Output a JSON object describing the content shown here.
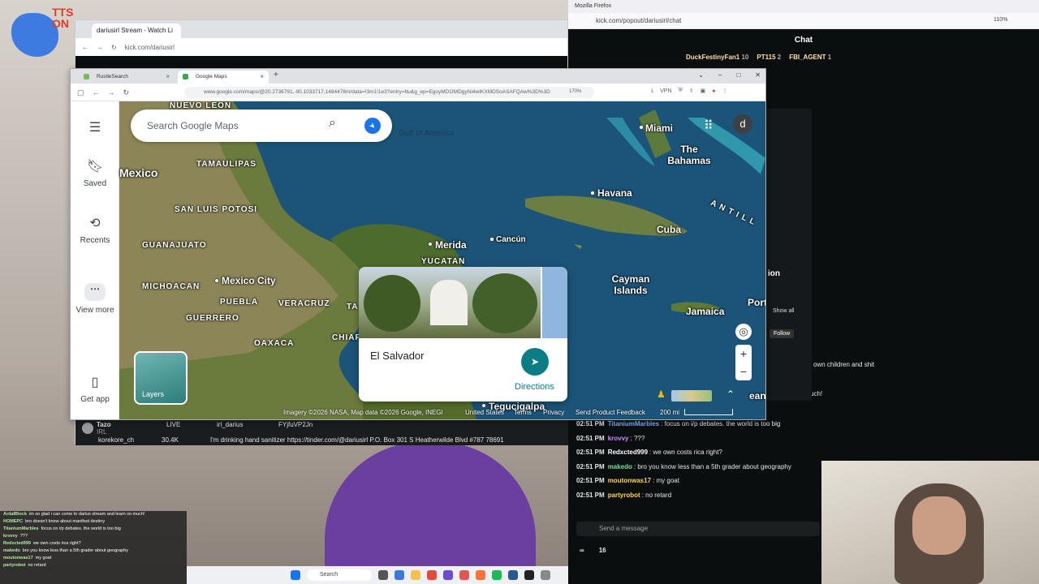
{
  "overlay_logo": {
    "text_line1": "TTS",
    "text_line2": "ON"
  },
  "stream_window": {
    "tab_title": "dariusirl Stream - Watch Li",
    "url": "kick.com/dariusirl",
    "streamer": "Tazo",
    "streamer_sub": "IRL",
    "live_label": "LIVE",
    "viewer_user": "korekore_ch",
    "viewer_count": "30.4K",
    "handle_x": "irl_darius",
    "handle_discord": "FYjfuVP2Jn",
    "ticker": "I'm drinking hand sanitizer https://tinder.com/@dariusirl P.O. Box 301 S Heatherwilde Blvd #787 78691"
  },
  "chat_window": {
    "ff_title": "Mozilla Firefox",
    "url": "kick.com/popout/dariusirl/chat",
    "zoom": "110%",
    "header": "Chat",
    "leaders": [
      {
        "name": "DuckFestinyFan1",
        "count": "10"
      },
      {
        "name": "PT115",
        "count": "2"
      },
      {
        "name": "FBI_AGENT",
        "count": "1"
      }
    ],
    "messages": [
      {
        "time": "02:51 PM",
        "user": "TitaniumMarbles",
        "text": "focus on i/p debates. the world is too big",
        "color": "#7fb3ff"
      },
      {
        "time": "02:51 PM",
        "user": "krovvy",
        "text": "???",
        "color": "#c78bff"
      },
      {
        "time": "02:51 PM",
        "user": "Redxcted999",
        "text": "we own costs rica right?",
        "color": "#ffffff"
      },
      {
        "time": "02:51 PM",
        "user": "makedo",
        "text": "bro you know less than a 5th grader about geography",
        "color": "#6fe0a0"
      },
      {
        "time": "02:51 PM",
        "user": "moutonwas17",
        "text": "my goat",
        "color": "#ffd24d"
      },
      {
        "time": "02:51 PM",
        "user": "partyrobot",
        "text": "no retard",
        "color": "#ffd24d"
      }
    ],
    "input_placeholder": "Send a message",
    "footer_count": "16",
    "side_labels": {
      "show_all": "Show all",
      "follow": "Follow",
      "snippet1": "own children and shit",
      "snippet2": "uch!",
      "snippet3": "ion"
    }
  },
  "overlay_chat": [
    {
      "user": "ArdalBlock",
      "text": "im so glad i can come to darius stream and learn so much!"
    },
    {
      "user": "HOMEPC",
      "text": "bro doesn't know about manifest destiny"
    },
    {
      "user": "TitaniumMarbles",
      "text": "focus on i/p debates. the world is too big"
    },
    {
      "user": "krovvy",
      "text": "???"
    },
    {
      "user": "Redxcted999",
      "text": "we own costs rica right?"
    },
    {
      "user": "makedo",
      "text": "bro you know less than a 5th grader about geography"
    },
    {
      "user": "moutonwas17",
      "text": "my goat"
    },
    {
      "user": "partyrobot",
      "text": "no retard"
    }
  ],
  "taskbar": {
    "search_label": "Search"
  },
  "maps_window": {
    "tabs": [
      {
        "title": "RustleSearch"
      },
      {
        "title": "Google Maps"
      }
    ],
    "url": "www.google.com/maps/@20.2736791,-90.1033717,1484478m/data=!3m1!1e3?entry=ttu&g_ep=EgoyMDI2MDgyNi4wIKXMDSoASAFQAw%3D%3D",
    "zoom": "170%",
    "vpn_label": "VPN",
    "search_placeholder": "Search Google Maps",
    "rail": {
      "saved": "Saved",
      "recents": "Recents",
      "view_more": "View more",
      "get_app": "Get app"
    },
    "account_initial": "d",
    "labels": {
      "nuevo_leon": "NUEVO LEON",
      "mexico": "Mexico",
      "tamaulipas": "TAMAULIPAS",
      "san_luis_potosi": "SAN LUIS POTOSI",
      "guanajuato": "GUANAJUATO",
      "michoacan": "MICHOACAN",
      "mexico_city": "Mexico City",
      "puebla": "PUEBLA",
      "veracruz": "VERACRUZ",
      "guerrero": "GUERRERO",
      "oaxaca": "OAXACA",
      "chiapas": "CHIAP",
      "tabasco": "TA",
      "yucatan": "YUCATAN",
      "merida": "Merida",
      "cancun": "Cancún",
      "gulf": "Gulf of America",
      "miami": "Miami",
      "bahamas": "The Bahamas",
      "havana": "Havana",
      "cuba": "Cuba",
      "antilles": "A N T I L L",
      "cayman": "Cayman Islands",
      "jamaica": "Jamaica",
      "port": "Port",
      "tegucigalpa": "Tegucigalpa",
      "ocean": "ean"
    },
    "place_card": {
      "name": "El Salvador",
      "directions": "Directions"
    },
    "layers_label": "Layers",
    "attribution": {
      "imagery": "Imagery ©2026 NASA, Map data ©2026 Google, INEGI",
      "country": "United States",
      "terms": "Terms",
      "privacy": "Privacy",
      "feedback": "Send Product Feedback",
      "scale": "200 mi"
    }
  }
}
